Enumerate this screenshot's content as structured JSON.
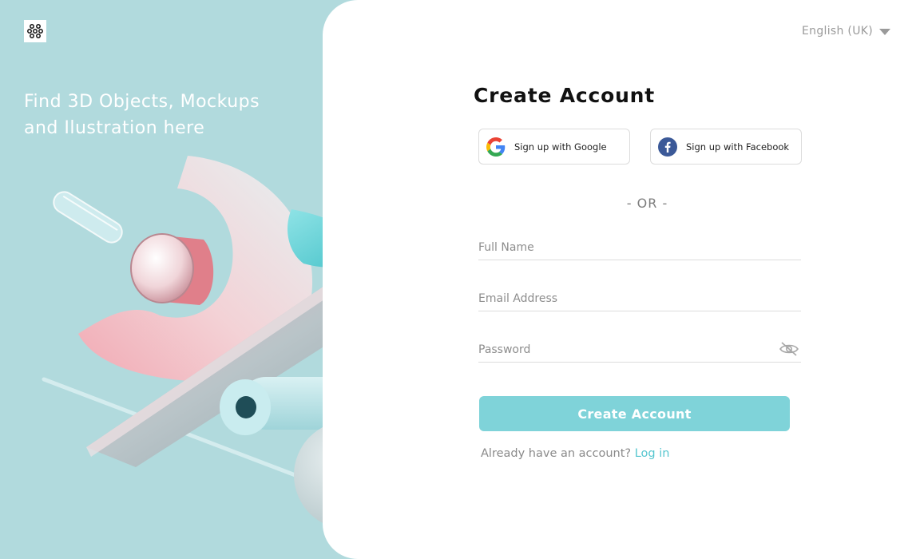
{
  "brand": {
    "logo_icon": "grid-logo-icon",
    "tagline_line1": "Find 3D Objects, Mockups",
    "tagline_line2": "and Ilustration here"
  },
  "language": {
    "selected": "English (UK)"
  },
  "form": {
    "title": "Create Account",
    "google_label": "Sign up with Google",
    "facebook_label": "Sign up with Facebook",
    "separator": "- OR -",
    "fullname_placeholder": "Full Name",
    "email_placeholder": "Email Address",
    "password_placeholder": "Password",
    "submit_label": "Create Account",
    "login_prompt": "Already have an account?",
    "login_link": "Log in"
  },
  "colors": {
    "panel_bg": "#b1dadd",
    "accent": "#7fd3d9",
    "link": "#56c6cf"
  }
}
